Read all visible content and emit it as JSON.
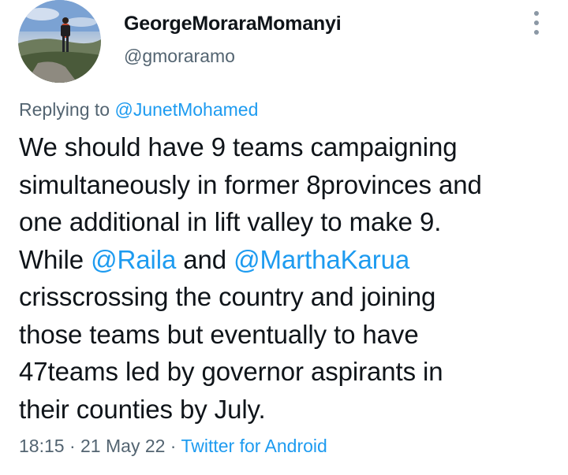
{
  "author": {
    "display_name": "GeorgeMoraraMomanyi",
    "handle": "@gmoraramo",
    "avatar_icon": "profile-photo"
  },
  "reply": {
    "prefix": "Replying to ",
    "to": "@JunetMohamed"
  },
  "tweet": {
    "line1": "We should have 9 teams campaigning",
    "line2": "simultaneously in former 8provinces and",
    "line3": "one additional in lift valley to make 9.",
    "line4_a": "While ",
    "line4_mention1": "@Raila",
    "line4_b": " and ",
    "line4_mention2": "@MarthaKarua",
    "line5": "crisscrossing the country and joining",
    "line6": "those teams but eventually to have",
    "line7": "47teams led by governor aspirants in",
    "line8": "their counties by July."
  },
  "meta": {
    "time": "18:15",
    "sep1": " · ",
    "date": "21 May 22",
    "sep2": " · ",
    "source": "Twitter for Android"
  },
  "colors": {
    "link": "#1d9bf0",
    "secondary_text": "#536471",
    "primary_text": "#0f1419"
  }
}
